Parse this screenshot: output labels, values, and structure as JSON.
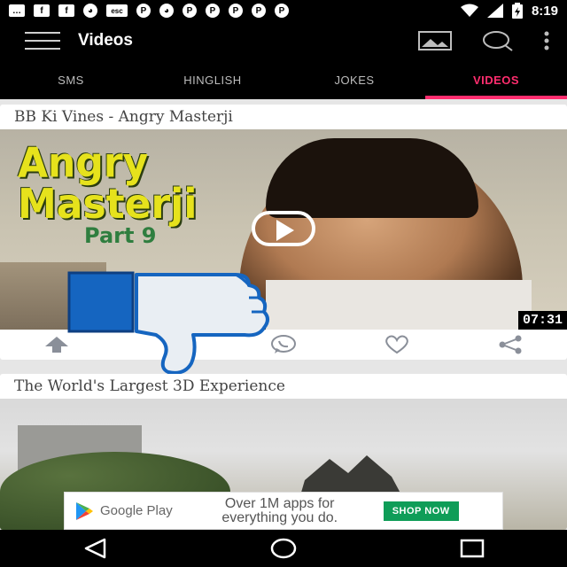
{
  "status_bar": {
    "left_icons": [
      "chat-icon",
      "facebook-icon",
      "facebook-icon",
      "cat-icon",
      "esc-icon",
      "pinterest-icon",
      "cat-icon",
      "pinterest-icon",
      "pinterest-icon",
      "pinterest-icon",
      "pinterest-icon",
      "pinterest-icon"
    ],
    "esc_label": "esc",
    "time": "8:19"
  },
  "app_bar": {
    "title": "Videos"
  },
  "tabs": [
    {
      "label": "SMS",
      "active": false
    },
    {
      "label": "HINGLISH",
      "active": false
    },
    {
      "label": "JOKES",
      "active": false
    },
    {
      "label": "VIDEOS",
      "active": true
    }
  ],
  "cards": [
    {
      "title": "BB Ki Vines - Angry Masterji",
      "thumb_line1": "Angry",
      "thumb_line2": "Masterji",
      "thumb_line3": "Part 9",
      "duration": "07:31"
    },
    {
      "title": "The World's Largest 3D Experience"
    }
  ],
  "ad": {
    "brand": "Google Play",
    "text_line1": "Over 1M apps for",
    "text_line2": "everything you do.",
    "cta": "SHOP NOW"
  },
  "colors": {
    "accent": "#ff2d6e",
    "bar_background": "#000000",
    "card_background": "#ffffff",
    "thumbs_down_blue": "#1565c0",
    "cta_green": "#0f9d58"
  }
}
